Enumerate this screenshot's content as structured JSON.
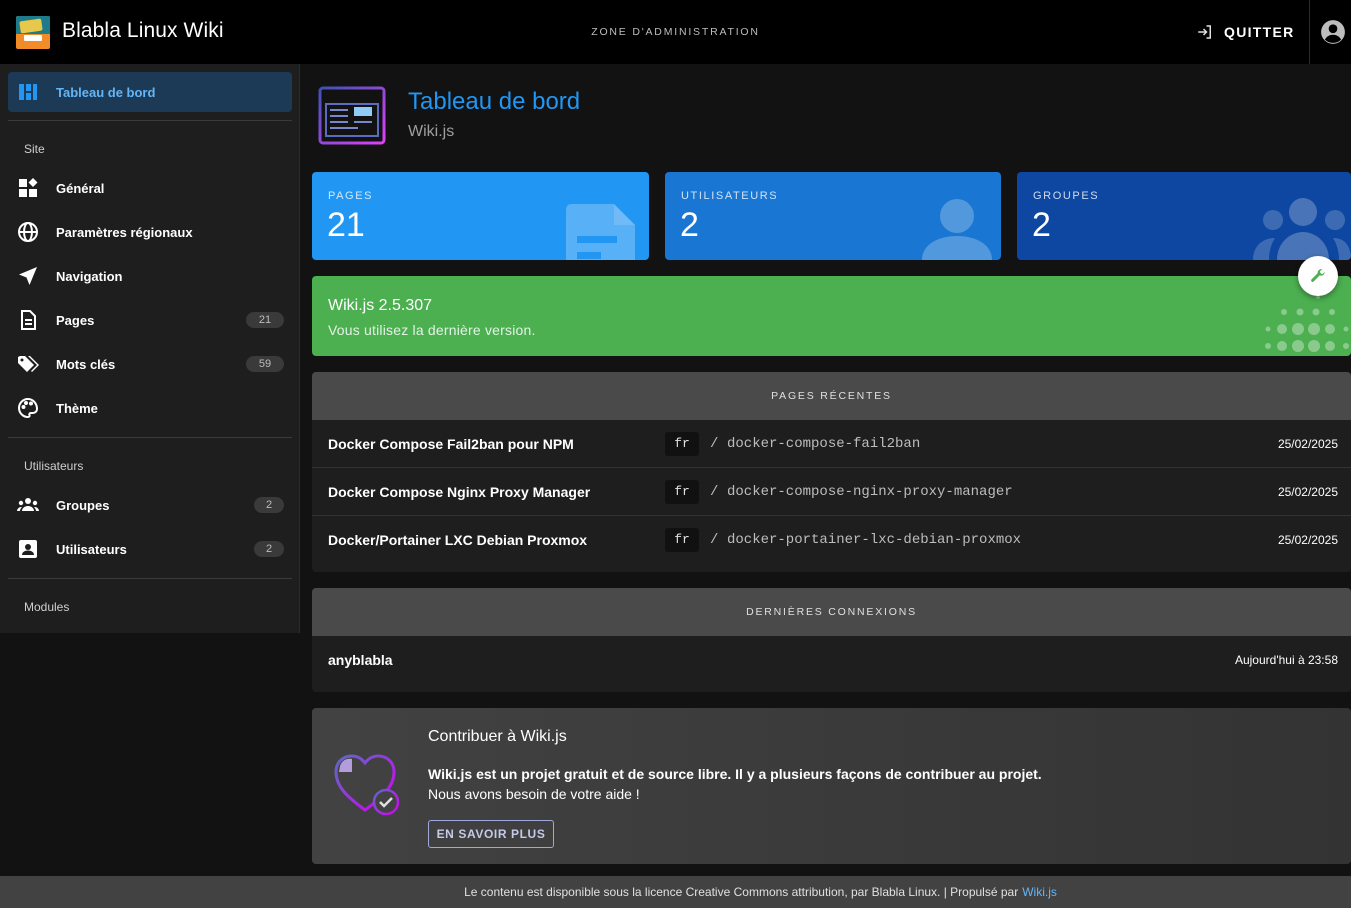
{
  "header": {
    "app_title": "Blabla Linux Wiki",
    "zone_label": "ZONE D'ADMINISTRATION",
    "quit_label": "QUITTER"
  },
  "sidebar": {
    "dashboard": "Tableau de bord",
    "site_header": "Site",
    "general": "Général",
    "locale": "Paramètres régionaux",
    "navigation": "Navigation",
    "pages": "Pages",
    "pages_count": "21",
    "tags": "Mots clés",
    "tags_count": "59",
    "theme": "Thème",
    "users_header": "Utilisateurs",
    "groups": "Groupes",
    "groups_count": "2",
    "users": "Utilisateurs",
    "users_count": "2",
    "modules_header": "Modules"
  },
  "main": {
    "title": "Tableau de bord",
    "subtitle": "Wiki.js"
  },
  "stats": {
    "pages_caption": "PAGES",
    "pages_value": "21",
    "users_caption": "UTILISATEURS",
    "users_value": "2",
    "groups_caption": "GROUPES",
    "groups_value": "2"
  },
  "version": {
    "name": "Wiki.js 2.5.307",
    "status": "Vous utilisez la dernière version."
  },
  "recent_pages": {
    "header": "PAGES RÉCENTES",
    "rows": [
      {
        "title": "Docker Compose Fail2ban pour NPM",
        "locale": "fr",
        "slash": "/",
        "path": "docker-compose-fail2ban",
        "date": "25/02/2025"
      },
      {
        "title": "Docker Compose Nginx Proxy Manager",
        "locale": "fr",
        "slash": "/",
        "path": "docker-compose-nginx-proxy-manager",
        "date": "25/02/2025"
      },
      {
        "title": "Docker/Portainer LXC Debian Proxmox",
        "locale": "fr",
        "slash": "/",
        "path": "docker-portainer-lxc-debian-proxmox",
        "date": "25/02/2025"
      }
    ]
  },
  "last_logins": {
    "header": "DERNIÈRES CONNEXIONS",
    "rows": [
      {
        "user": "anyblabla",
        "time": "Aujourd'hui à 23:58"
      }
    ]
  },
  "contribute": {
    "title": "Contribuer à Wiki.js",
    "line1": "Wiki.js est un projet gratuit et de source libre. Il y a plusieurs façons de contribuer au projet.",
    "line2": "Nous avons besoin de votre aide !",
    "button": "EN SAVOIR PLUS"
  },
  "footer": {
    "text": "Le contenu est disponible sous la licence Creative Commons attribution, par Blabla Linux. | Propulsé par",
    "link": "Wiki.js"
  },
  "colors": {
    "accent": "#2196f3",
    "card_pages": "#2196f3",
    "card_users": "#1976d2",
    "card_groups": "#0d47a1",
    "version_ok": "#4caf50"
  }
}
